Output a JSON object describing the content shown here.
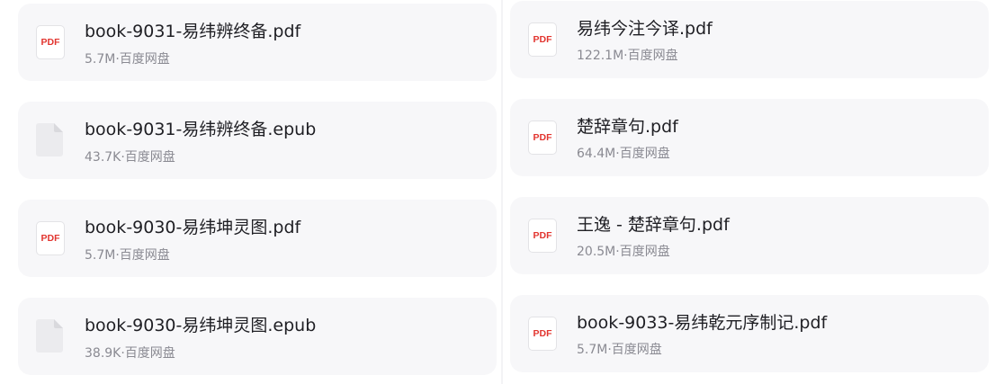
{
  "left_column": {
    "items": [
      {
        "name": "book-9031-易纬辨终备.pdf",
        "meta": "5.7M·百度网盘",
        "icon": "pdf-icon",
        "badge": "PDF"
      },
      {
        "name": "book-9031-易纬辨终备.epub",
        "meta": "43.7K·百度网盘",
        "icon": "generic-file-icon",
        "badge": ""
      },
      {
        "name": "book-9030-易纬坤灵图.pdf",
        "meta": "5.7M·百度网盘",
        "icon": "pdf-icon",
        "badge": "PDF"
      },
      {
        "name": "book-9030-易纬坤灵图.epub",
        "meta": "38.9K·百度网盘",
        "icon": "generic-file-icon",
        "badge": ""
      }
    ]
  },
  "right_column": {
    "items": [
      {
        "name": "易纬今注今译.pdf",
        "meta": "122.1M·百度网盘",
        "icon": "pdf-icon",
        "badge": "PDF"
      },
      {
        "name": "楚辞章句.pdf",
        "meta": "64.4M·百度网盘",
        "icon": "pdf-icon",
        "badge": "PDF"
      },
      {
        "name": "王逸 - 楚辞章句.pdf",
        "meta": "20.5M·百度网盘",
        "icon": "pdf-icon",
        "badge": "PDF"
      },
      {
        "name": "book-9033-易纬乾元序制记.pdf",
        "meta": "5.7M·百度网盘",
        "icon": "pdf-icon",
        "badge": "PDF"
      }
    ]
  },
  "colors": {
    "card_bg": "#f7f7f9",
    "pdf_red": "#e2352f",
    "title_text": "#1f1f24",
    "meta_text": "#8a8a92"
  }
}
